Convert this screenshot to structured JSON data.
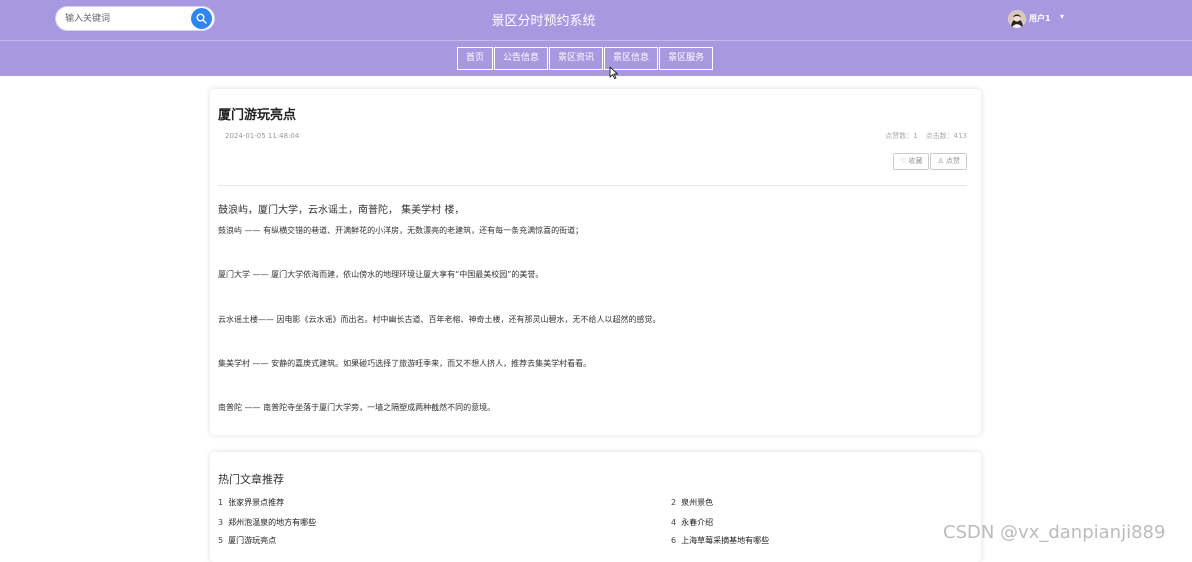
{
  "header": {
    "site_title": "景区分时预约系统",
    "search": {
      "placeholder": "输入关键词",
      "value": ""
    },
    "user": {
      "name": "用户1"
    },
    "caret": "▾"
  },
  "nav": {
    "items": [
      {
        "label": "首页"
      },
      {
        "label": "公告信息"
      },
      {
        "label": "景区资讯"
      },
      {
        "label": "景区信息"
      },
      {
        "label": "景区服务"
      }
    ]
  },
  "article": {
    "title": "厦门游玩亮点",
    "date": "2024-01-05 11:48:04",
    "likes_text": "点赞数：1",
    "clicks_text": "点击数：413",
    "favorite_label": "收藏",
    "like_label": "点赞",
    "intro": "鼓浪屿，厦门大学，云水谣土，南普陀， 集美学村 楼，",
    "paragraphs": [
      "鼓浪屿 —— 有纵横交错的巷道、开满鲜花的小洋房，无数漂亮的老建筑，还有每一条充满惊喜的街道；",
      "厦门大学 —— 厦门大学依海而建，依山傍水的地理环境让厦大享有“中国最美校园”的美誉。",
      " 云水谣土楼—— 因电影《云水谣》而出名。村中幽长古道、百年老榕、神奇土楼，还有那灵山碧水，无不给人以超然的感觉。",
      " 集美学村 —— 安静的嘉庚式建筑。如果碰巧选择了旅游旺季来，而又不想人挤人，推荐去集美学村看看。",
      " 南普陀 —— 南普陀寺坐落于厦门大学旁，一墙之隔塑成两种截然不同的意境。"
    ]
  },
  "hot": {
    "title": "热门文章推荐",
    "items": [
      {
        "num": "1",
        "title": "张家界景点推荐"
      },
      {
        "num": "2",
        "title": "泉州景色"
      },
      {
        "num": "3",
        "title": "郑州泡温泉的地方有哪些"
      },
      {
        "num": "4",
        "title": "永春介绍"
      },
      {
        "num": "5",
        "title": "厦门游玩亮点"
      },
      {
        "num": "6",
        "title": "上海草莓采摘基地有哪些"
      }
    ]
  },
  "watermark": "CSDN @vx_danpianji889",
  "colors": {
    "header_bg": "#a898e0",
    "search_button": "#2f86f0"
  }
}
